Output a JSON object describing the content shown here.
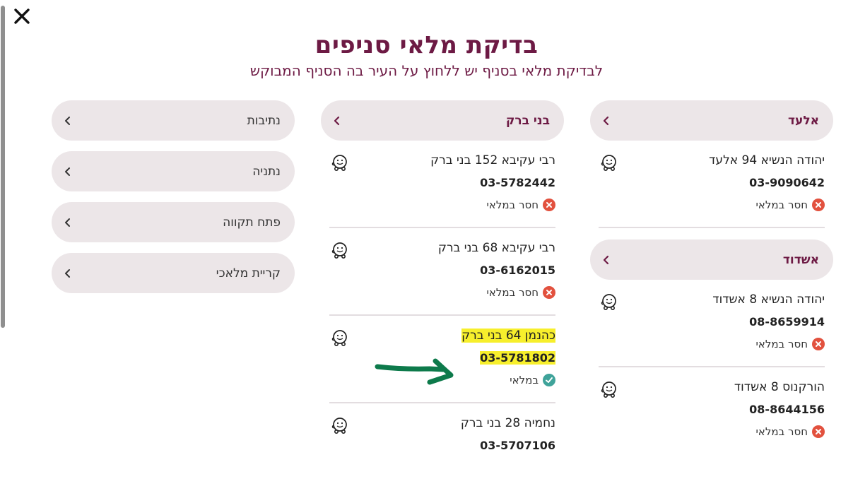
{
  "page": {
    "title": "בדיקת מלאי סניפים",
    "subtitle": "לבדיקת מלאי בסניף יש ללחוץ על העיר בה הסניף המבוקש"
  },
  "colors": {
    "brand": "#6d1a44",
    "pill_bg": "#ece6e8",
    "out_of_stock": "#e2513e",
    "in_stock": "#3fa39a",
    "highlight": "#f7ef2c",
    "annotation_arrow": "#0d7a4b"
  },
  "icons": {
    "close": "close-icon",
    "chevron": "chevron-left-icon",
    "waze": "waze-icon",
    "out": "x-circle-icon",
    "in": "check-circle-icon"
  },
  "right_column": {
    "city1": {
      "label": "אלעד",
      "branches": [
        {
          "address": "יהודה הנשיא 94 אלעד",
          "phone": "03-9090642",
          "status": "חסר במלאי"
        }
      ]
    },
    "city2": {
      "label": "אשדוד",
      "branches": [
        {
          "address": "יהודה הנשיא 8 אשדוד",
          "phone": "08-8659914",
          "status": "חסר במלאי"
        },
        {
          "address": "הורקנוס 8 אשדוד",
          "phone": "08-8644156",
          "status": "חסר במלאי"
        }
      ]
    }
  },
  "middle_column": {
    "city": {
      "label": "בני ברק",
      "branches": [
        {
          "address": "רבי עקיבא 152 בני ברק",
          "phone": "03-5782442",
          "status": "חסר במלאי"
        },
        {
          "address": "רבי עקיבא 68 בני ברק",
          "phone": "03-6162015",
          "status": "חסר במלאי"
        },
        {
          "address": "כהנמן 64 בני ברק",
          "phone": "03-5781802",
          "status": "במלאי"
        },
        {
          "address": "נחמיה 28 בני ברק",
          "phone": "03-5707106"
        }
      ]
    }
  },
  "left_column": {
    "cities": [
      "נתיבות",
      "נתניה",
      "פתח תקווה",
      "קריית מלאכי"
    ]
  }
}
